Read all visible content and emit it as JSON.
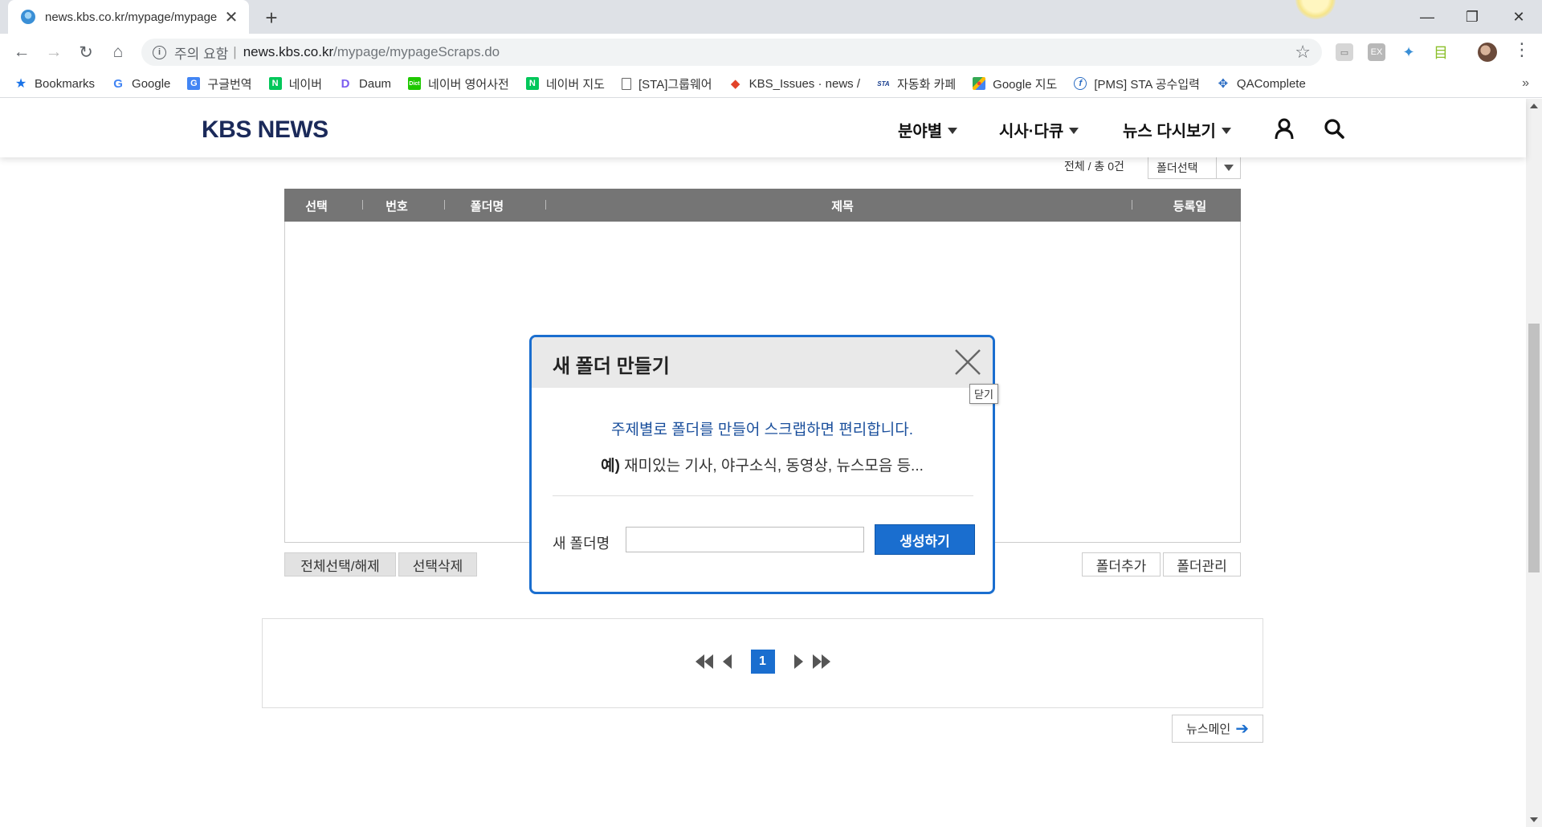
{
  "browser": {
    "tab_title": "news.kbs.co.kr/mypage/mypage",
    "address_warning": "주의 요함",
    "address_host": "news.kbs.co.kr",
    "address_path": "/mypage/mypageScraps.do",
    "bookmarks": [
      {
        "label": "Bookmarks",
        "icon": "star-icon"
      },
      {
        "label": "Google",
        "icon": "google-icon"
      },
      {
        "label": "구글번역",
        "icon": "translate-icon"
      },
      {
        "label": "네이버",
        "icon": "naver-icon"
      },
      {
        "label": "Daum",
        "icon": "daum-icon"
      },
      {
        "label": "네이버 영어사전",
        "icon": "dict-icon"
      },
      {
        "label": "네이버 지도",
        "icon": "naver-icon"
      },
      {
        "label": "[STA]그룹웨어",
        "icon": "page-icon"
      },
      {
        "label": "KBS_Issues · news / ",
        "icon": "gitlab-icon"
      },
      {
        "label": "자동화 카페",
        "icon": "sta-icon"
      },
      {
        "label": "Google 지도",
        "icon": "maps-icon"
      },
      {
        "label": "[PMS] STA 공수입력",
        "icon": "pms-icon"
      },
      {
        "label": "QAComplete",
        "icon": "qa-icon"
      }
    ],
    "bookmarks_more": "»"
  },
  "site": {
    "logo": "KBS NEWS",
    "nav": [
      {
        "label": "분야별"
      },
      {
        "label": "시사·다큐"
      },
      {
        "label": "뉴스 다시보기"
      }
    ]
  },
  "scraps": {
    "count_text": "전체 / 총 0건",
    "folder_select": "폴더선택",
    "columns": [
      "선택",
      "번호",
      "폴더명",
      "제목",
      "등록일"
    ],
    "rows": [],
    "select_all_button": "전체선택/해제",
    "delete_selected_button": "선택삭제",
    "add_folder_button": "폴더추가",
    "manage_folder_button": "폴더관리",
    "current_page": "1",
    "news_main_button": "뉴스메인",
    "news_main_arrow": "➔"
  },
  "modal": {
    "title": "새 폴더 만들기",
    "close_tooltip": "닫기",
    "message1": "주제별로 폴더를 만들어 스크랩하면 편리합니다.",
    "message2_prefix": "예)",
    "message2": " 재미있는 기사, 야구소식, 동영상, 뉴스모음 등...",
    "folder_name_label": "새 폴더명",
    "folder_name_value": "",
    "create_button": "생성하기"
  },
  "colors": {
    "accent": "#1a6ecf",
    "table_header": "#757575",
    "logo": "#1b2a5a",
    "message": "#1a4f9c"
  }
}
